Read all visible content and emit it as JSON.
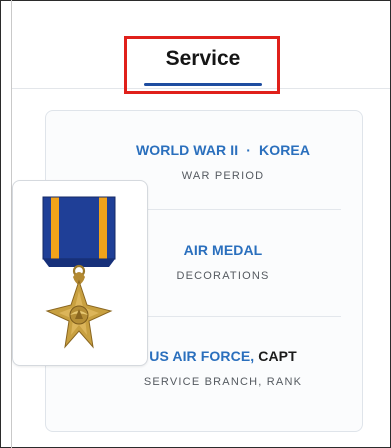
{
  "tabs": {
    "active_label": "Service"
  },
  "war_period": {
    "value_1": "WORLD WAR II",
    "separator": "·",
    "value_2": "KOREA",
    "label": "WAR PERIOD"
  },
  "decorations": {
    "value": "AIR MEDAL",
    "label": "DECORATIONS"
  },
  "service_branch": {
    "branch": "US AIR FORCE,",
    "rank": "CAPT",
    "label": "SERVICE BRANCH, RANK"
  },
  "colors": {
    "link_blue": "#2a6fbd",
    "tab_underline": "#1e4da0",
    "highlight_red": "#e0201b",
    "ribbon_blue": "#1f3f97",
    "ribbon_orange": "#f2a31a",
    "medal_gold": "#c8a040"
  },
  "medal_image": {
    "icon": "air-medal-icon"
  }
}
